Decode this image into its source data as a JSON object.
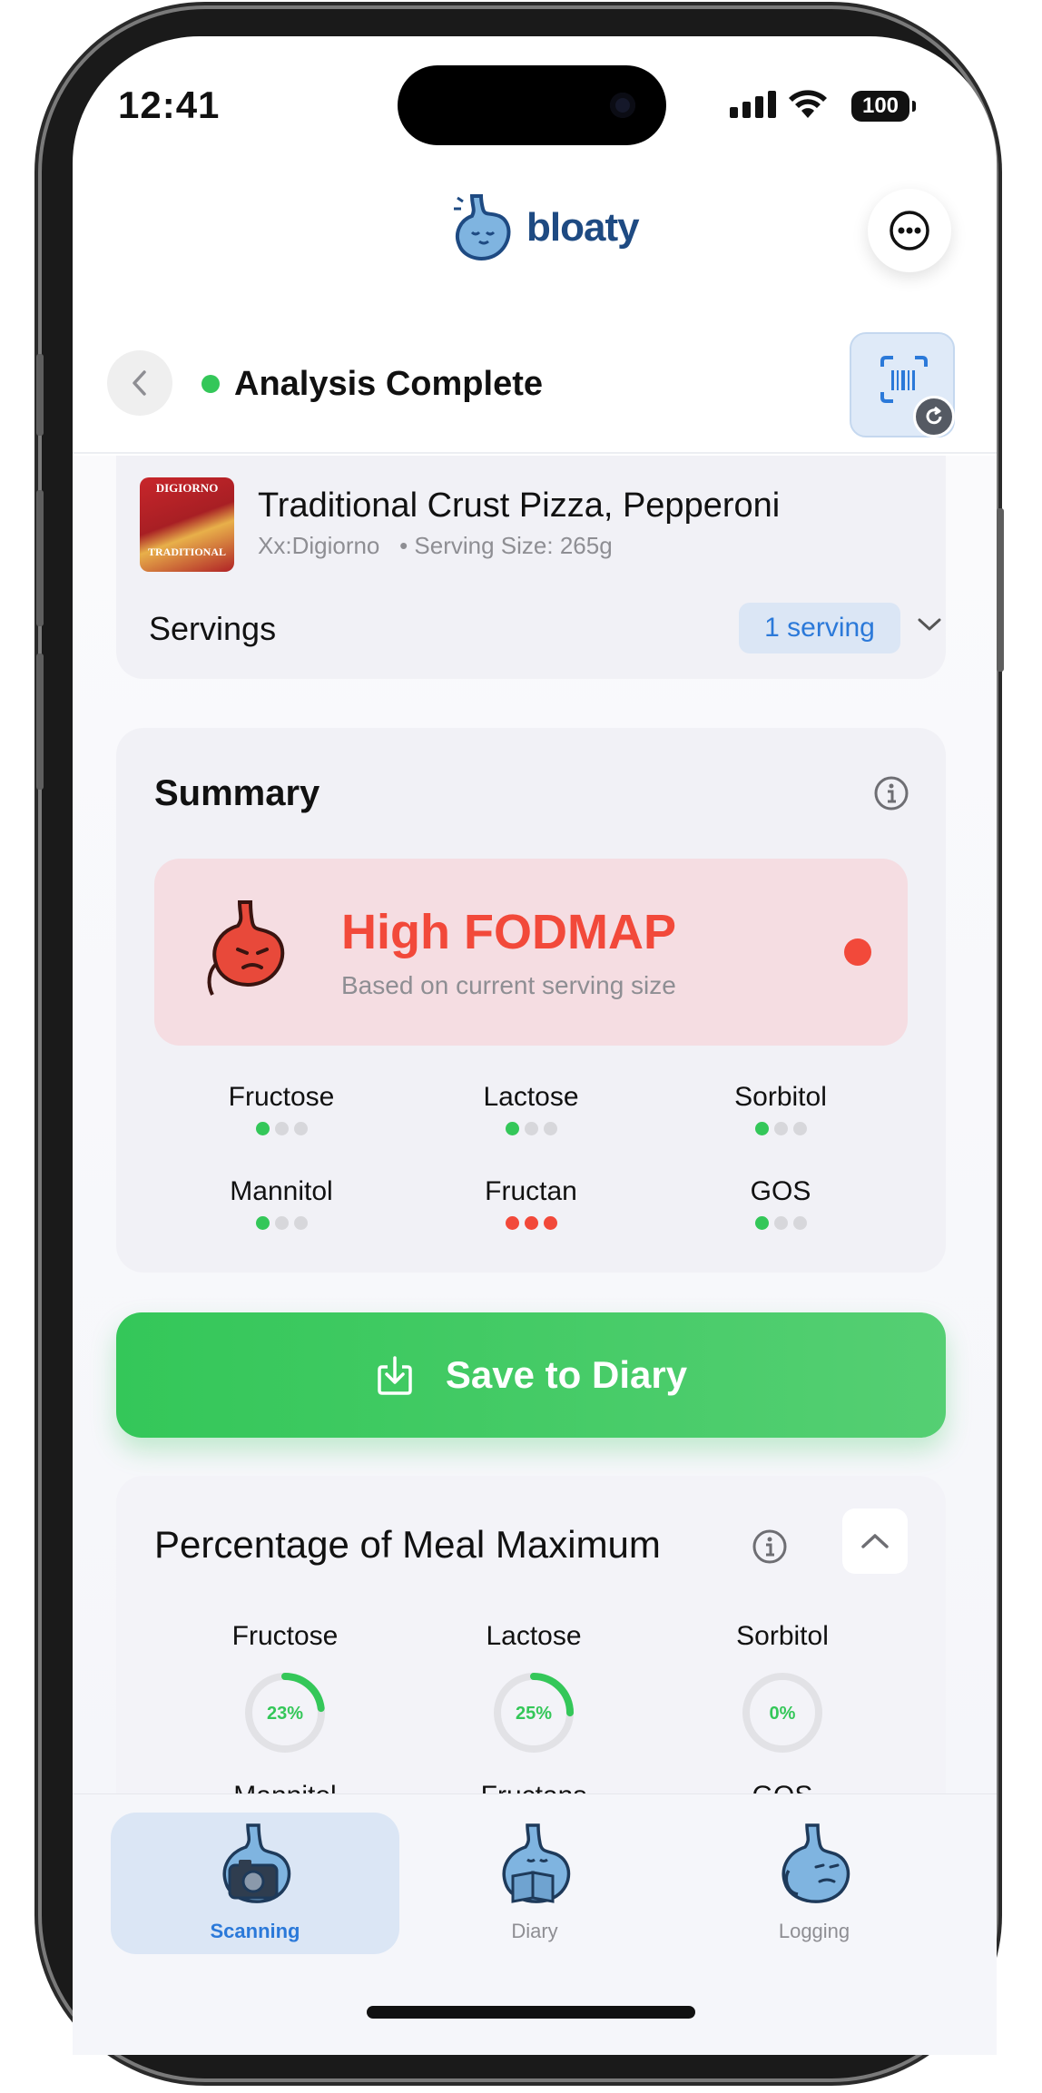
{
  "status_bar": {
    "time": "12:41",
    "battery": "100"
  },
  "header": {
    "logo_text": "bloaty",
    "more_icon": "ellipsis-circle-icon"
  },
  "analysis": {
    "title": "Analysis Complete",
    "status_color": "#34c759",
    "back_icon": "chevron-left-icon",
    "scan_icon": "barcode-scan-icon"
  },
  "product": {
    "name": "Traditional Crust Pizza, Pepperoni",
    "brand": "Xx:Digiorno",
    "separator": "•",
    "serving_size": "Serving Size: 265g",
    "thumb_brand": "DIGIORNO",
    "thumb_kind": "TRADITIONAL",
    "servings_label": "Servings",
    "servings_value": "1 serving"
  },
  "summary": {
    "title": "Summary",
    "rating": "High FODMAP",
    "rating_sub": "Based on current serving size",
    "rating_color": "#f2493a",
    "nutrients": [
      {
        "label": "Fructose",
        "level": 1,
        "color": "green"
      },
      {
        "label": "Lactose",
        "level": 1,
        "color": "green"
      },
      {
        "label": "Sorbitol",
        "level": 1,
        "color": "green"
      },
      {
        "label": "Mannitol",
        "level": 1,
        "color": "green"
      },
      {
        "label": "Fructan",
        "level": 3,
        "color": "red"
      },
      {
        "label": "GOS",
        "level": 1,
        "color": "green"
      }
    ]
  },
  "save_button": {
    "label": "Save to Diary",
    "icon": "download-tray-icon"
  },
  "percentage": {
    "title": "Percentage of Meal Maximum",
    "items": [
      {
        "label": "Fructose",
        "value": 23,
        "text": "23%"
      },
      {
        "label": "Lactose",
        "value": 25,
        "text": "25%"
      },
      {
        "label": "Sorbitol",
        "value": 0,
        "text": "0%"
      },
      {
        "label": "Mannitol"
      },
      {
        "label": "Fructans"
      },
      {
        "label": "GOS"
      }
    ]
  },
  "tabs": [
    {
      "label": "Scanning",
      "active": true
    },
    {
      "label": "Diary",
      "active": false
    },
    {
      "label": "Logging",
      "active": false
    }
  ],
  "colors": {
    "accent_blue": "#2b79d9",
    "green": "#34c759",
    "red": "#f2493a"
  }
}
